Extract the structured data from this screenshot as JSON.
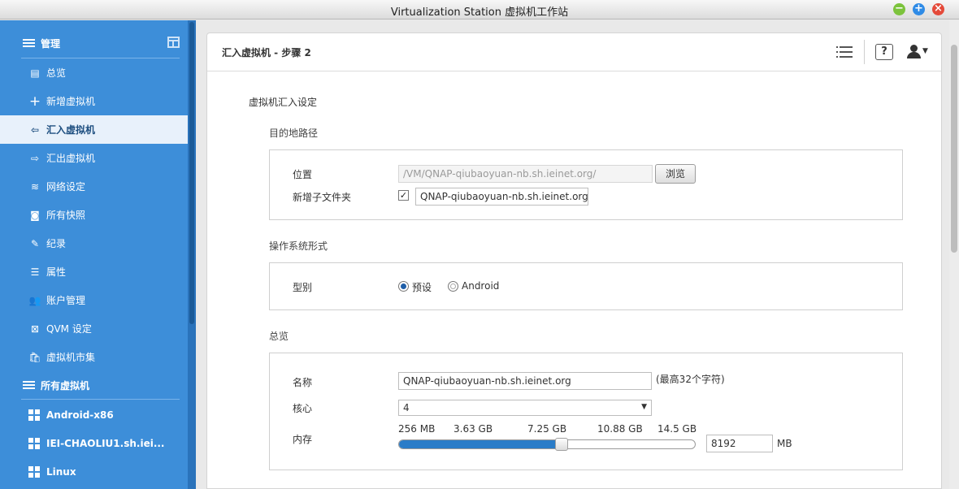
{
  "window": {
    "title": "Virtualization Station 虚拟机工作站"
  },
  "sidebar": {
    "manage_label": "管理",
    "items": [
      {
        "label": "总览",
        "icon": "overview-icon"
      },
      {
        "label": "新增虚拟机",
        "icon": "plus-icon"
      },
      {
        "label": "汇入虚拟机",
        "icon": "import-icon"
      },
      {
        "label": "汇出虚拟机",
        "icon": "export-icon"
      },
      {
        "label": "网络设定",
        "icon": "network-icon"
      },
      {
        "label": "所有快照",
        "icon": "camera-icon"
      },
      {
        "label": "纪录",
        "icon": "log-icon"
      },
      {
        "label": "属性",
        "icon": "properties-icon"
      },
      {
        "label": "账户管理",
        "icon": "accounts-icon"
      },
      {
        "label": "QVM 设定",
        "icon": "qvm-icon"
      },
      {
        "label": "虚拟机市集",
        "icon": "market-icon"
      }
    ],
    "active_index": 2,
    "all_vms_label": "所有虚拟机",
    "vms": [
      {
        "label": "Android-x86"
      },
      {
        "label": "IEI-CHAOLIU1.sh.iei..."
      },
      {
        "label": "Linux"
      }
    ]
  },
  "panel": {
    "title": "汇入虚拟机 - 步骤 2",
    "heading": "虚拟机汇入设定",
    "destination": {
      "title": "目的地路径",
      "location_label": "位置",
      "location_value": "/VM/QNAP-qiubaoyuan-nb.sh.ieinet.org/",
      "browse_label": "浏览",
      "new_folder_label": "新增子文件夹",
      "new_folder_checked": true,
      "new_folder_value": "QNAP-qiubaoyuan-nb.sh.ieinet.org"
    },
    "os": {
      "title": "操作系统形式",
      "type_label": "型别",
      "options": [
        "预设",
        "Android"
      ],
      "selected": "预设"
    },
    "overview": {
      "title": "总览",
      "name_label": "名称",
      "name_value": "QNAP-qiubaoyuan-nb.sh.ieinet.org",
      "name_hint": "(最高32个字符)",
      "cores_label": "核心",
      "cores_value": "4",
      "memory_label": "内存",
      "memory_ticks": [
        "256 MB",
        "3.63 GB",
        "7.25 GB",
        "10.88 GB",
        "14.5 GB"
      ],
      "memory_value": "8192",
      "memory_unit": "MB",
      "memory_fraction": 0.55
    }
  }
}
